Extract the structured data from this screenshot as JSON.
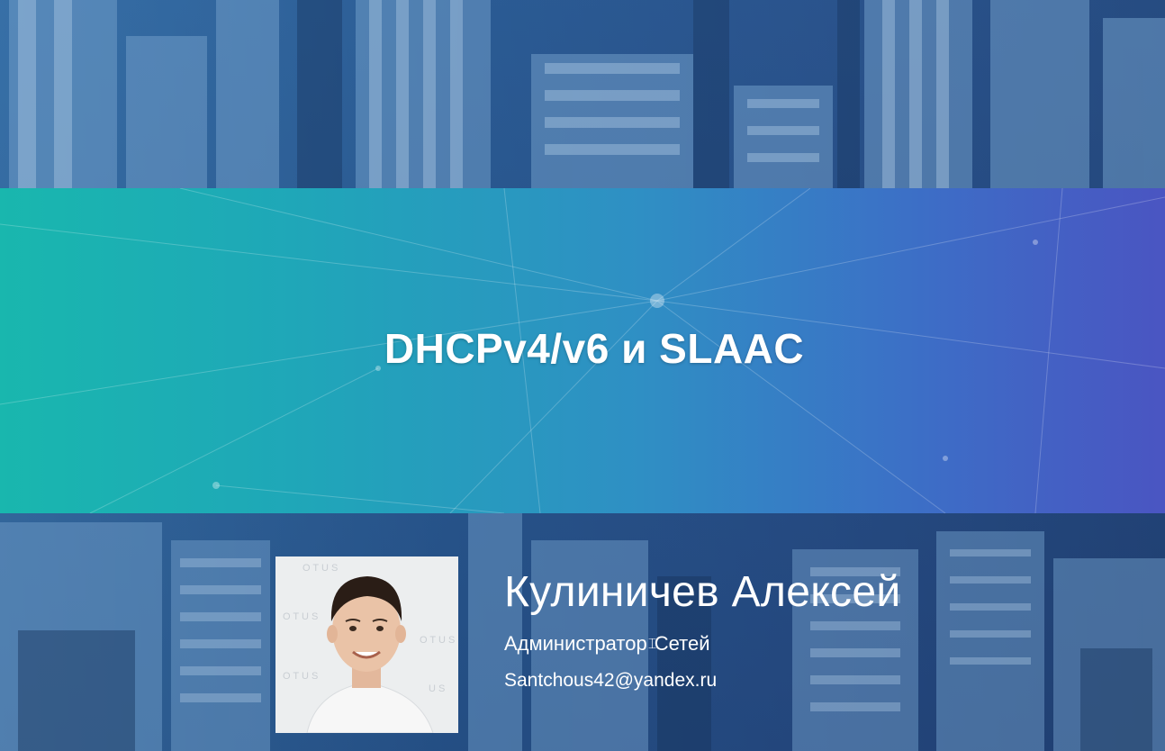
{
  "slide": {
    "title": "DHCPv4/v6 и SLAAC",
    "author": {
      "name": "Кулиничев Алексей",
      "role_part1": "Администратор",
      "role_part2": "Сетей",
      "email": "Santchous42@yandex.ru",
      "photo_logo_text": "OTUS"
    }
  },
  "colors": {
    "banner_start": "#19b7ae",
    "banner_end": "#4a55c2",
    "city_tint": "#2c5c93",
    "text": "#ffffff"
  },
  "icons": {
    "cursor": "i-beam-cursor-icon"
  }
}
